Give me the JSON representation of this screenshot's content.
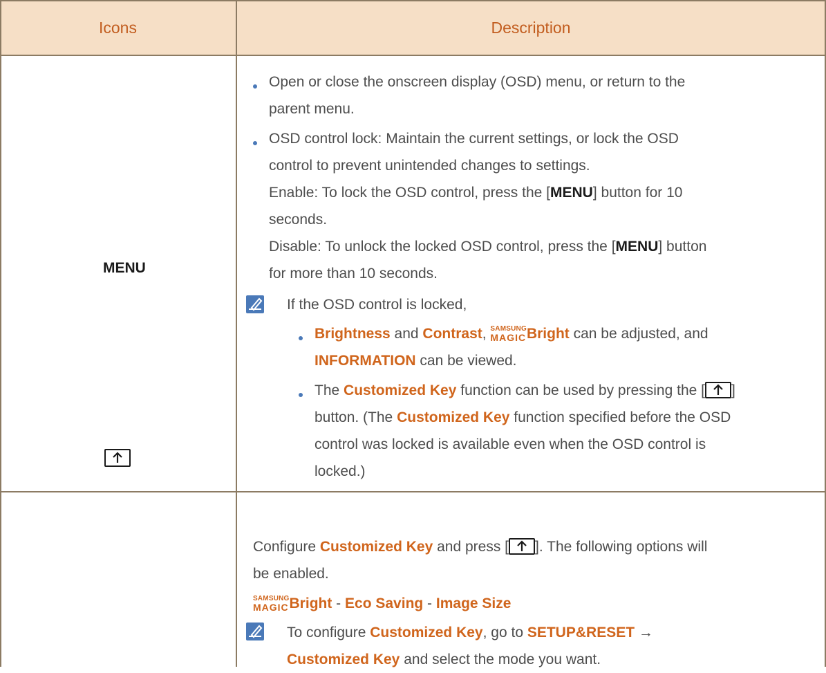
{
  "table": {
    "headers": {
      "icons": "Icons",
      "description": "Description"
    }
  },
  "row1": {
    "icon_label": "MENU",
    "bullet1": {
      "line1": "Open or close the onscreen display (OSD) menu, or return to the",
      "line2": "parent menu."
    },
    "bullet2": {
      "line1": "OSD control lock: Maintain the current settings, or lock the OSD",
      "line2": "control to prevent unintended changes to settings.",
      "line3_pre": "Enable: To lock the OSD control, press the [",
      "line3_kw": "MENU",
      "line3_post": "] button for 10",
      "line4": "seconds.",
      "line5_pre": "Disable: To unlock the locked OSD control, press the [",
      "line5_kw": "MENU",
      "line5_post": "] button",
      "line6": "for more than 10 seconds."
    },
    "note": {
      "intro": "If the OSD control is locked,",
      "sub1": {
        "brightness": "Brightness",
        "and": " and ",
        "contrast": "Contrast",
        "comma": ", ",
        "samsung": "SAMSUNG",
        "magic": "MAGIC",
        "bright": "Bright",
        "tail": " can be adjusted, and",
        "information": "INFORMATION",
        "tail2": " can be viewed."
      },
      "sub2": {
        "pre": "The ",
        "customized_key": "Customized Key",
        "mid": " function can be used by pressing the [",
        "post": "]",
        "line2_pre": "button. (The ",
        "line2_kw": "Customized Key",
        "line2_post": " function specified before the OSD",
        "line3": "control was locked is available even when the OSD control is",
        "line4": "locked.)"
      }
    }
  },
  "row2": {
    "line1_pre": "Configure ",
    "line1_kw": "Customized Key",
    "line1_mid": " and press [",
    "line1_post": "]. The following options will",
    "line2": "be enabled.",
    "options": {
      "samsung": "SAMSUNG",
      "magic": "MAGIC",
      "bright": "Bright",
      "sep1": " - ",
      "eco": "Eco Saving",
      "sep2": " - ",
      "image": "Image Size"
    },
    "note": {
      "pre": "To configure ",
      "kw1": "Customized Key",
      "mid": ", go to ",
      "kw2": "SETUP&RESET",
      "arrow": "  →",
      "kw3": "Customized Key",
      "post": " and select the mode you want."
    }
  },
  "colors": {
    "header_bg": "#f6dfc6",
    "header_text": "#c25d1f",
    "accent": "#d0651c",
    "bullet": "#4a79b8"
  }
}
